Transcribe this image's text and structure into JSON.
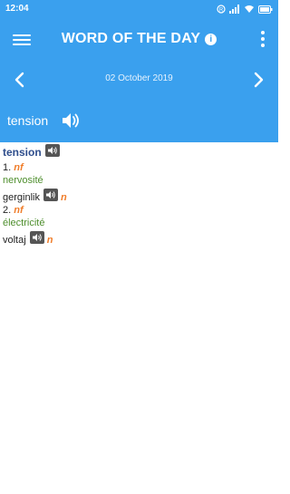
{
  "status_bar": {
    "time": "12:04"
  },
  "app_bar": {
    "title": "WORD OF THE DAY",
    "info_glyph": "i"
  },
  "date_nav": {
    "date": "02 October 2019"
  },
  "word": {
    "text": "tension"
  },
  "entry": {
    "headword": "tension",
    "senses": [
      {
        "number": "1.",
        "pos": "nf",
        "meaning": "nervosité",
        "translation": "gerginlik",
        "translation_pos": "n"
      },
      {
        "number": "2.",
        "pos": "nf",
        "meaning": "électricité",
        "translation": "voltaj",
        "translation_pos": "n"
      }
    ]
  },
  "colors": {
    "accent": "#3aa0ee",
    "headword": "#2f4e8c",
    "pos": "#f07d2a",
    "meaning": "#4f8f2e"
  },
  "icons": [
    "menu-icon",
    "info-icon",
    "more-vert-icon",
    "chevron-left-icon",
    "chevron-right-icon",
    "speaker-icon"
  ]
}
